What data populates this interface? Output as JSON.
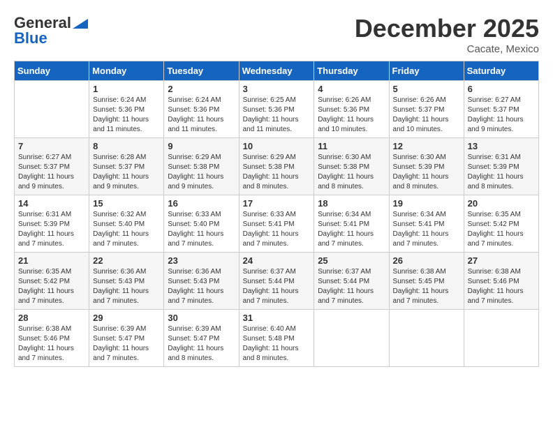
{
  "header": {
    "logo_general": "General",
    "logo_blue": "Blue",
    "month_title": "December 2025",
    "location": "Cacate, Mexico"
  },
  "calendar": {
    "days_of_week": [
      "Sunday",
      "Monday",
      "Tuesday",
      "Wednesday",
      "Thursday",
      "Friday",
      "Saturday"
    ],
    "weeks": [
      [
        {
          "day": "",
          "info": ""
        },
        {
          "day": "1",
          "info": "Sunrise: 6:24 AM\nSunset: 5:36 PM\nDaylight: 11 hours\nand 11 minutes."
        },
        {
          "day": "2",
          "info": "Sunrise: 6:24 AM\nSunset: 5:36 PM\nDaylight: 11 hours\nand 11 minutes."
        },
        {
          "day": "3",
          "info": "Sunrise: 6:25 AM\nSunset: 5:36 PM\nDaylight: 11 hours\nand 11 minutes."
        },
        {
          "day": "4",
          "info": "Sunrise: 6:26 AM\nSunset: 5:36 PM\nDaylight: 11 hours\nand 10 minutes."
        },
        {
          "day": "5",
          "info": "Sunrise: 6:26 AM\nSunset: 5:37 PM\nDaylight: 11 hours\nand 10 minutes."
        },
        {
          "day": "6",
          "info": "Sunrise: 6:27 AM\nSunset: 5:37 PM\nDaylight: 11 hours\nand 9 minutes."
        }
      ],
      [
        {
          "day": "7",
          "info": "Sunrise: 6:27 AM\nSunset: 5:37 PM\nDaylight: 11 hours\nand 9 minutes."
        },
        {
          "day": "8",
          "info": "Sunrise: 6:28 AM\nSunset: 5:37 PM\nDaylight: 11 hours\nand 9 minutes."
        },
        {
          "day": "9",
          "info": "Sunrise: 6:29 AM\nSunset: 5:38 PM\nDaylight: 11 hours\nand 9 minutes."
        },
        {
          "day": "10",
          "info": "Sunrise: 6:29 AM\nSunset: 5:38 PM\nDaylight: 11 hours\nand 8 minutes."
        },
        {
          "day": "11",
          "info": "Sunrise: 6:30 AM\nSunset: 5:38 PM\nDaylight: 11 hours\nand 8 minutes."
        },
        {
          "day": "12",
          "info": "Sunrise: 6:30 AM\nSunset: 5:39 PM\nDaylight: 11 hours\nand 8 minutes."
        },
        {
          "day": "13",
          "info": "Sunrise: 6:31 AM\nSunset: 5:39 PM\nDaylight: 11 hours\nand 8 minutes."
        }
      ],
      [
        {
          "day": "14",
          "info": "Sunrise: 6:31 AM\nSunset: 5:39 PM\nDaylight: 11 hours\nand 7 minutes."
        },
        {
          "day": "15",
          "info": "Sunrise: 6:32 AM\nSunset: 5:40 PM\nDaylight: 11 hours\nand 7 minutes."
        },
        {
          "day": "16",
          "info": "Sunrise: 6:33 AM\nSunset: 5:40 PM\nDaylight: 11 hours\nand 7 minutes."
        },
        {
          "day": "17",
          "info": "Sunrise: 6:33 AM\nSunset: 5:41 PM\nDaylight: 11 hours\nand 7 minutes."
        },
        {
          "day": "18",
          "info": "Sunrise: 6:34 AM\nSunset: 5:41 PM\nDaylight: 11 hours\nand 7 minutes."
        },
        {
          "day": "19",
          "info": "Sunrise: 6:34 AM\nSunset: 5:41 PM\nDaylight: 11 hours\nand 7 minutes."
        },
        {
          "day": "20",
          "info": "Sunrise: 6:35 AM\nSunset: 5:42 PM\nDaylight: 11 hours\nand 7 minutes."
        }
      ],
      [
        {
          "day": "21",
          "info": "Sunrise: 6:35 AM\nSunset: 5:42 PM\nDaylight: 11 hours\nand 7 minutes."
        },
        {
          "day": "22",
          "info": "Sunrise: 6:36 AM\nSunset: 5:43 PM\nDaylight: 11 hours\nand 7 minutes."
        },
        {
          "day": "23",
          "info": "Sunrise: 6:36 AM\nSunset: 5:43 PM\nDaylight: 11 hours\nand 7 minutes."
        },
        {
          "day": "24",
          "info": "Sunrise: 6:37 AM\nSunset: 5:44 PM\nDaylight: 11 hours\nand 7 minutes."
        },
        {
          "day": "25",
          "info": "Sunrise: 6:37 AM\nSunset: 5:44 PM\nDaylight: 11 hours\nand 7 minutes."
        },
        {
          "day": "26",
          "info": "Sunrise: 6:38 AM\nSunset: 5:45 PM\nDaylight: 11 hours\nand 7 minutes."
        },
        {
          "day": "27",
          "info": "Sunrise: 6:38 AM\nSunset: 5:46 PM\nDaylight: 11 hours\nand 7 minutes."
        }
      ],
      [
        {
          "day": "28",
          "info": "Sunrise: 6:38 AM\nSunset: 5:46 PM\nDaylight: 11 hours\nand 7 minutes."
        },
        {
          "day": "29",
          "info": "Sunrise: 6:39 AM\nSunset: 5:47 PM\nDaylight: 11 hours\nand 7 minutes."
        },
        {
          "day": "30",
          "info": "Sunrise: 6:39 AM\nSunset: 5:47 PM\nDaylight: 11 hours\nand 8 minutes."
        },
        {
          "day": "31",
          "info": "Sunrise: 6:40 AM\nSunset: 5:48 PM\nDaylight: 11 hours\nand 8 minutes."
        },
        {
          "day": "",
          "info": ""
        },
        {
          "day": "",
          "info": ""
        },
        {
          "day": "",
          "info": ""
        }
      ]
    ]
  }
}
